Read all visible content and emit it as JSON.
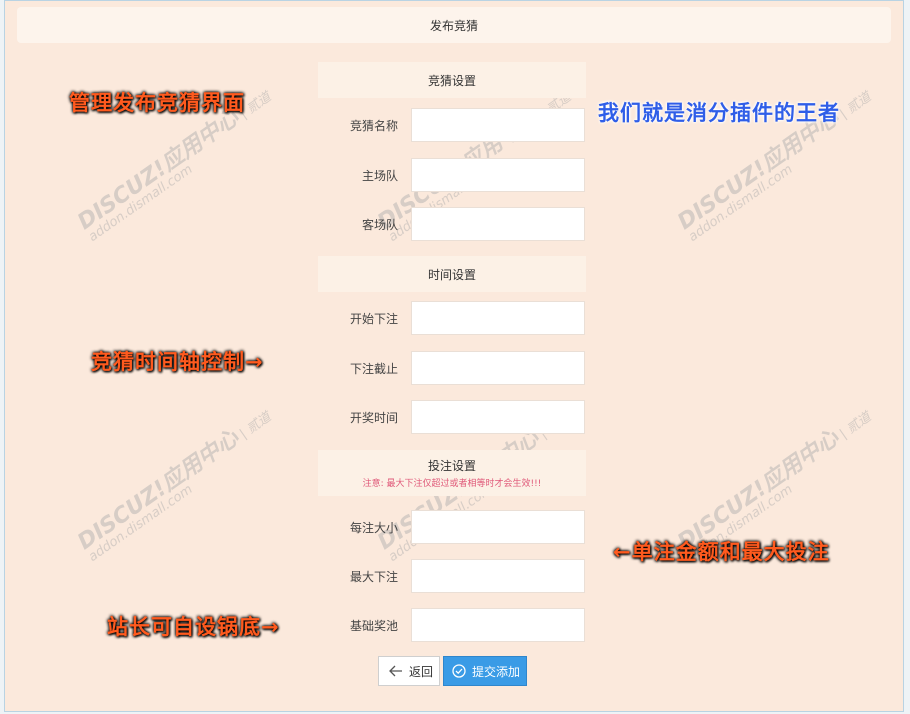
{
  "header": {
    "title": "发布竞猜"
  },
  "sections": {
    "guess": {
      "title": "竞猜设置"
    },
    "time": {
      "title": "时间设置"
    },
    "bet": {
      "title": "投注设置",
      "note": "注意: 最大下注仅超过或者相等时才会生效!!!"
    }
  },
  "fields": {
    "name": {
      "label": "竞猜名称",
      "value": ""
    },
    "home": {
      "label": "主场队",
      "value": ""
    },
    "away": {
      "label": "客场队",
      "value": ""
    },
    "start": {
      "label": "开始下注",
      "value": ""
    },
    "deadline": {
      "label": "下注截止",
      "value": ""
    },
    "draw": {
      "label": "开奖时间",
      "value": ""
    },
    "per_bet": {
      "label": "每注大小",
      "value": ""
    },
    "max_bet": {
      "label": "最大下注",
      "value": ""
    },
    "pool": {
      "label": "基础奖池",
      "value": ""
    }
  },
  "buttons": {
    "back": "返回",
    "submit": "提交添加"
  },
  "callouts": {
    "admin": "管理发布竞猜界面",
    "king": "我们就是消分插件的王者",
    "timeline": "竞猜时间轴控制→",
    "amount": "←单注金额和最大投注",
    "pool": "站长可自设锅底→"
  },
  "watermark": {
    "brand": "DISCUZ!应用中心",
    "domain": "addon.dismall.com",
    "owner": "贰道"
  },
  "colors": {
    "accent": "#3a9be6",
    "page_bg": "#fbe9dc",
    "callout_orange": "#ff5a1e",
    "callout_blue": "#2f5ee8",
    "note": "#e05a7a"
  }
}
